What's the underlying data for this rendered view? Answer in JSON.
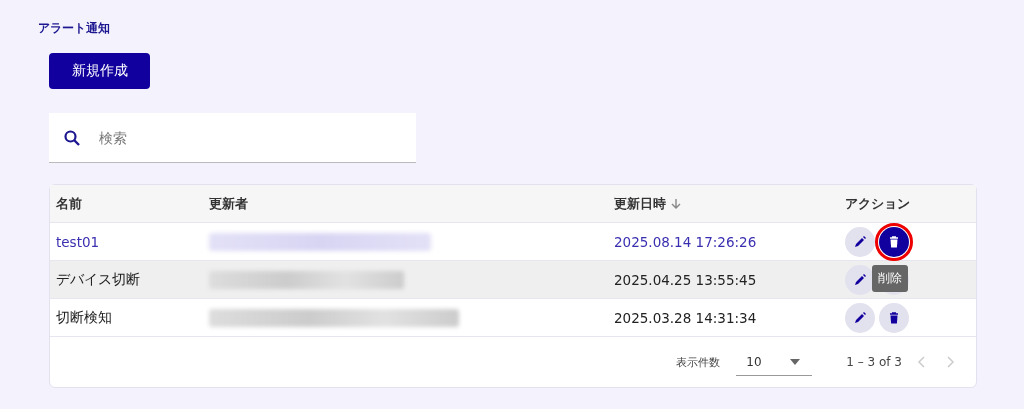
{
  "page_title": "アラート通知",
  "create_button": "新規作成",
  "search": {
    "placeholder": "検索"
  },
  "table": {
    "columns": [
      {
        "label": "名前",
        "sorted": false
      },
      {
        "label": "更新者",
        "sorted": false
      },
      {
        "label": "更新日時",
        "sorted": true
      },
      {
        "label": "アクション",
        "sorted": false
      }
    ],
    "rows": [
      {
        "name": "test01",
        "updater": {
          "kind": "redacted"
        },
        "updated_at": "2025.08.14 17:26:26",
        "selected": true,
        "hovered": false,
        "delete_focused": true,
        "tooltip": null
      },
      {
        "name": "デバイス切断",
        "updater": {
          "kind": "redacted"
        },
        "updated_at": "2025.04.25 13:55:45",
        "selected": false,
        "hovered": true,
        "delete_focused": false,
        "tooltip": "削除"
      },
      {
        "name": "切断検知",
        "updater": {
          "kind": "redacted"
        },
        "updated_at": "2025.03.28 14:31:34",
        "selected": false,
        "hovered": false,
        "delete_focused": false,
        "tooltip": null
      }
    ]
  },
  "pagination": {
    "page_size_label": "表示件数",
    "page_size": "10",
    "range": "1 – 3 of 3",
    "prev_disabled": true,
    "next_disabled": true
  }
}
